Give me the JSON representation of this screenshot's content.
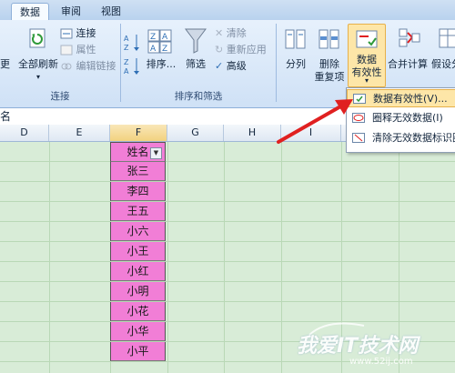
{
  "tabs": [
    {
      "label": "数据",
      "active": true
    },
    {
      "label": "审阅",
      "active": false
    },
    {
      "label": "视图",
      "active": false
    }
  ],
  "ribbon": {
    "connections": {
      "refresh_left_partial": "更",
      "refresh_all": "全部刷新",
      "connections": "连接",
      "properties": "属性",
      "edit_links": "编辑链接",
      "group_label": "连接"
    },
    "sort_filter": {
      "sort": "排序...",
      "filter": "筛选",
      "clear": "清除",
      "reapply": "重新应用",
      "advanced": "高级",
      "group_label": "排序和筛选"
    },
    "data_tools": {
      "text_to_columns": "分列",
      "remove_duplicates_1": "删除",
      "remove_duplicates_2": "重复项",
      "validation_1": "数据",
      "validation_2": "有效性",
      "consolidate": "合并计算",
      "what_if": "假设分"
    }
  },
  "formula_bar": {
    "name_box_partial": "名"
  },
  "columns": [
    "D",
    "E",
    "F",
    "G",
    "H",
    "I"
  ],
  "table": {
    "header": "姓名",
    "names": [
      "张三",
      "李四",
      "王五",
      "小六",
      "小王",
      "小红",
      "小明",
      "小花",
      "小华",
      "小平"
    ]
  },
  "validation_menu": {
    "items": [
      {
        "label": "数据有效性(V)...",
        "highlighted": true
      },
      {
        "label": "圈释无效数据(I)",
        "highlighted": false
      },
      {
        "label": "清除无效数据标识圈",
        "highlighted": false
      }
    ]
  },
  "watermark": {
    "brand": "我爱IT技术网",
    "url": "www.52ij.com"
  },
  "colors": {
    "header_fill": "#f17ed6",
    "sheet_bg": "#d8ecd7",
    "arrow": "#e02020",
    "menu_highlight": "#fde6a8"
  }
}
